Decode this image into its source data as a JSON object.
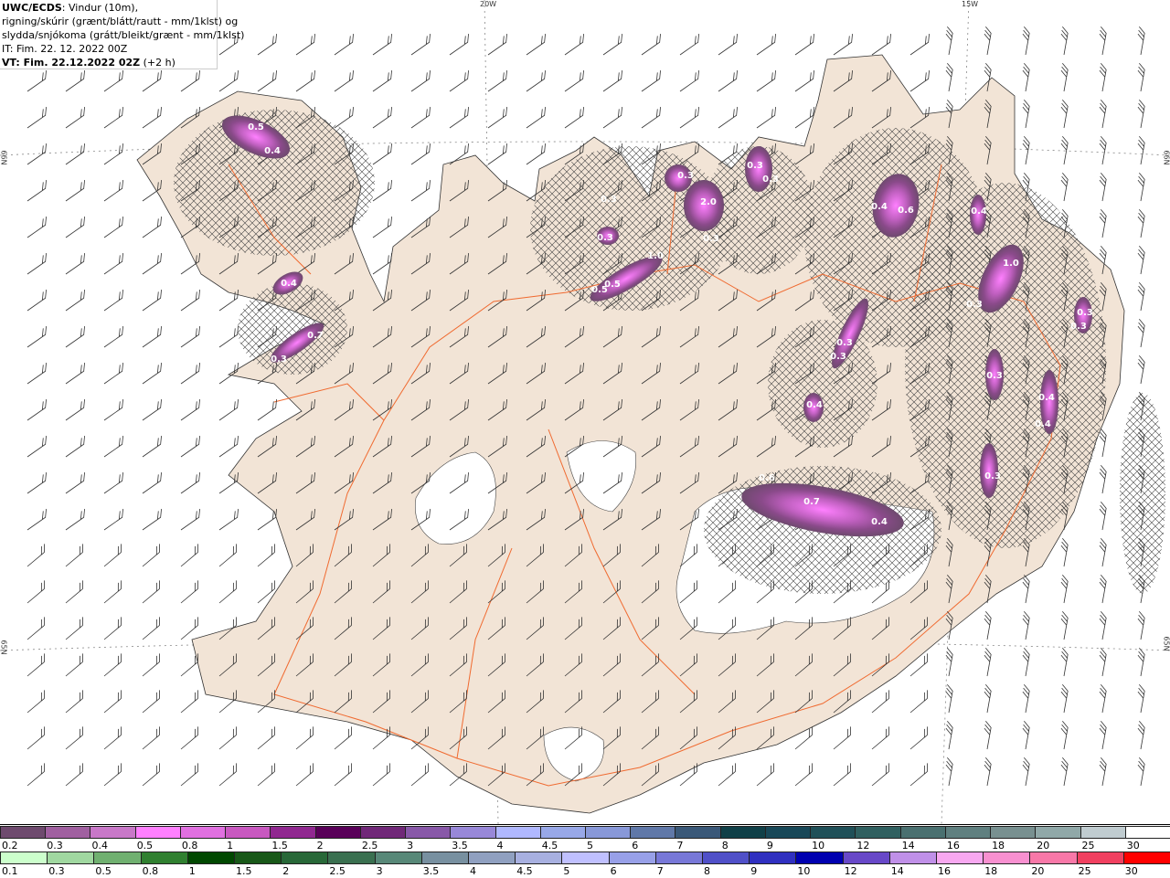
{
  "header": {
    "source": "UWC/ECDS",
    "line1_rest": ": Vindur (10m),",
    "line2": "rigning/skúrir (grænt/blátt/rautt - mm/1klst) og",
    "line3": "slydda/snjókoma (grátt/bleikt/grænt - mm/1klst)",
    "it": "IT: Fim. 22. 12. 2022 00Z",
    "vt": "VT: Fim. 22.12.2022 02Z",
    "vt_offset": "(+2 h)"
  },
  "grid_labels": {
    "lon_20w": "20W",
    "lon_15w": "15W",
    "lat_66n_left": "66N",
    "lat_66n_right": "66N",
    "lat_65n_left": "65N",
    "lat_65n_right": "65N"
  },
  "precip_labels": [
    "0.5",
    "0.4",
    "0.4",
    "0.7",
    "0.3",
    "0.3",
    "0.3",
    "2.0",
    "0.3",
    "0.3",
    "0.3",
    "1.0",
    "0.5",
    "0.5",
    "0.4",
    "0.6",
    "0.4",
    "1.0",
    "0.3",
    "0.3",
    "0.3",
    "0.3",
    "0.3",
    "0.3",
    "0.4",
    "0.3",
    "0.4",
    "0.4",
    "0.3",
    "0.6",
    "0.7",
    "0.4"
  ],
  "legend": {
    "snow": {
      "labels": [
        "0.2",
        "0.3",
        "0.4",
        "0.5",
        "0.8",
        "1",
        "1.5",
        "2",
        "2.5",
        "3",
        "3.5",
        "4",
        "4.5",
        "5",
        "6",
        "7",
        "8",
        "9",
        "10",
        "12",
        "14",
        "16",
        "18",
        "20",
        "25",
        "30"
      ],
      "colors": [
        "#6e4a6e",
        "#a060a0",
        "#c878c8",
        "#ff80ff",
        "#e070e0",
        "#c858c0",
        "#902890",
        "#580058",
        "#702878",
        "#8858a8",
        "#9888d8",
        "#b0b8ff",
        "#98a8e8",
        "#8898d8",
        "#6078a8",
        "#3a5878",
        "#104048",
        "#184858",
        "#205058",
        "#306060",
        "#4a7070",
        "#608080",
        "#789090",
        "#90a8a8",
        "#c0ccd0",
        "#ffffff"
      ]
    },
    "rain": {
      "labels": [
        "0.1",
        "0.3",
        "0.5",
        "0.8",
        "1",
        "1.5",
        "2",
        "2.5",
        "3",
        "3.5",
        "4",
        "4.5",
        "5",
        "6",
        "7",
        "8",
        "9",
        "10",
        "12",
        "14",
        "16",
        "18",
        "20",
        "25",
        "30"
      ],
      "colors": [
        "#ccffcc",
        "#a0d8a0",
        "#70b070",
        "#308030",
        "#004800",
        "#185818",
        "#286838",
        "#3a7050",
        "#588878",
        "#7890a0",
        "#90a0c0",
        "#a8b0e0",
        "#c0c0ff",
        "#98a0e8",
        "#7878d8",
        "#5050c8",
        "#3030c0",
        "#0000b0",
        "#6848c8",
        "#c090e8",
        "#f8a8f0",
        "#f890d0",
        "#f878a8",
        "#f04060",
        "#ff0000"
      ]
    }
  },
  "colors": {
    "land": "#f2e4d6",
    "road": "#f06a30",
    "glacier": "#ffffff"
  }
}
